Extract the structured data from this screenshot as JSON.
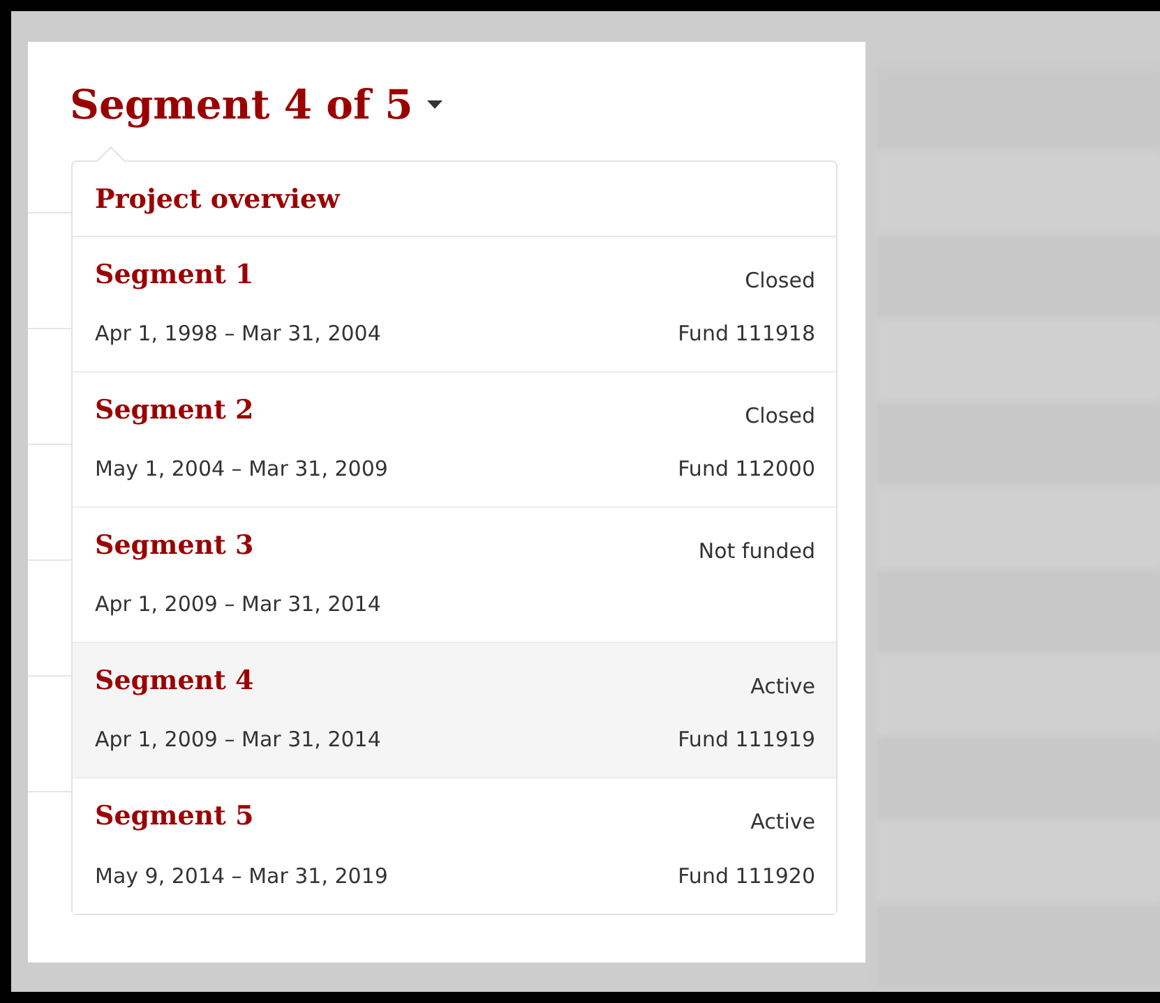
{
  "header": {
    "title": "Segment 4 of 5",
    "expanded": true
  },
  "menu": {
    "overview": "Project overview",
    "segments": [
      {
        "name": "Segment 1",
        "status": "Closed",
        "dates": "Apr 1, 1998 – Mar 31, 2004",
        "fund": "Fund 111918",
        "selected": false
      },
      {
        "name": "Segment 2",
        "status": "Closed",
        "dates": "May 1, 2004 – Mar 31, 2009",
        "fund": "Fund 112000",
        "selected": false
      },
      {
        "name": "Segment 3",
        "status": "Not funded",
        "dates": "Apr 1, 2009 – Mar 31, 2014",
        "selected": false
      },
      {
        "name": "Segment 4",
        "status": "Active",
        "dates": "Apr 1, 2009 – Mar 31, 2014",
        "fund": "Fund 111919",
        "selected": true
      },
      {
        "name": "Segment 5",
        "status": "Active",
        "dates": "May 9, 2014 – Mar 31, 2019",
        "fund": "Fund 111920",
        "selected": false
      }
    ]
  }
}
